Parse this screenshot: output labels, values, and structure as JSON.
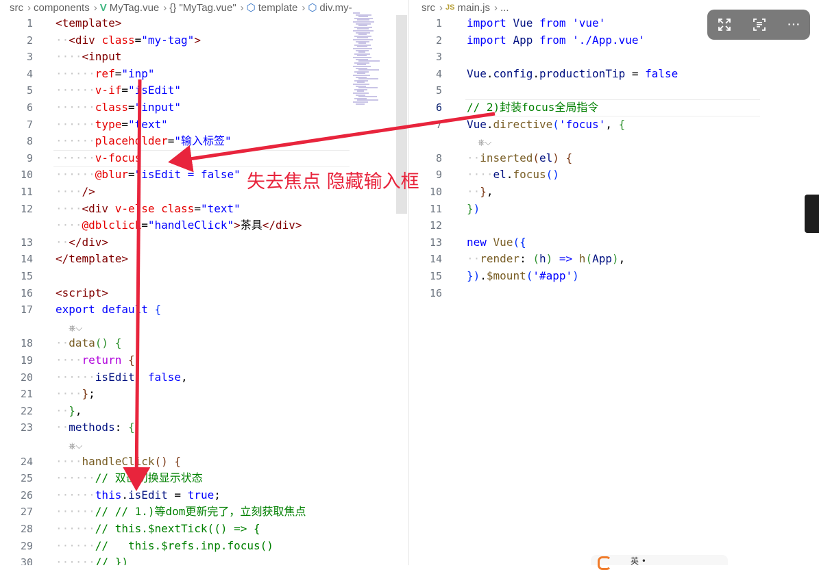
{
  "left_editor": {
    "breadcrumb": [
      "src",
      "components",
      "MyTag.vue",
      "{} \"MyTag.vue\"",
      "template",
      "div.my-"
    ],
    "codelens": "⎈⌵",
    "lines": [
      {
        "n": "1",
        "tokens": [
          [
            "t",
            "<template>"
          ]
        ]
      },
      {
        "n": "2",
        "tokens": [
          [
            "g",
            "··"
          ],
          [
            "t",
            "<div"
          ],
          [
            "p",
            " "
          ],
          [
            "a",
            "class"
          ],
          [
            "p",
            "="
          ],
          [
            "s",
            "\"my-tag\""
          ],
          [
            "t",
            ">"
          ]
        ]
      },
      {
        "n": "3",
        "tokens": [
          [
            "g",
            "····"
          ],
          [
            "t",
            "<input"
          ]
        ]
      },
      {
        "n": "4",
        "tokens": [
          [
            "g",
            "······"
          ],
          [
            "a",
            "ref"
          ],
          [
            "p",
            "="
          ],
          [
            "s",
            "\"inp\""
          ]
        ]
      },
      {
        "n": "5",
        "tokens": [
          [
            "g",
            "······"
          ],
          [
            "a",
            "v-if"
          ],
          [
            "p",
            "="
          ],
          [
            "s",
            "\"isEdit\""
          ]
        ]
      },
      {
        "n": "6",
        "tokens": [
          [
            "g",
            "······"
          ],
          [
            "a",
            "class"
          ],
          [
            "p",
            "="
          ],
          [
            "s",
            "\"input\""
          ]
        ]
      },
      {
        "n": "7",
        "tokens": [
          [
            "g",
            "······"
          ],
          [
            "a",
            "type"
          ],
          [
            "p",
            "="
          ],
          [
            "s",
            "\"text\""
          ]
        ]
      },
      {
        "n": "8",
        "tokens": [
          [
            "g",
            "······"
          ],
          [
            "a",
            "placeholder"
          ],
          [
            "p",
            "="
          ],
          [
            "s",
            "\"输入标签\""
          ]
        ]
      },
      {
        "n": "9",
        "tokens": [
          [
            "g",
            "······"
          ],
          [
            "a",
            "v-focus"
          ]
        ]
      },
      {
        "n": "10",
        "tokens": [
          [
            "g",
            "······"
          ],
          [
            "a",
            "@blur"
          ],
          [
            "p",
            "="
          ],
          [
            "s",
            "\"isEdit = false\""
          ]
        ]
      },
      {
        "n": "11",
        "tokens": [
          [
            "g",
            "····"
          ],
          [
            "t",
            "/>"
          ]
        ]
      },
      {
        "n": "12",
        "tokens": [
          [
            "g",
            "····"
          ],
          [
            "t",
            "<div"
          ],
          [
            "p",
            " "
          ],
          [
            "a",
            "v-else"
          ],
          [
            "p",
            " "
          ],
          [
            "a",
            "class"
          ],
          [
            "p",
            "="
          ],
          [
            "s",
            "\"text\""
          ],
          [
            "g",
            " "
          ]
        ]
      },
      {
        "n": "",
        "tokens": [
          [
            "g",
            "····"
          ],
          [
            "a",
            "@dblclick"
          ],
          [
            "p",
            "="
          ],
          [
            "s",
            "\"handleClick\""
          ],
          [
            "t",
            ">"
          ],
          [
            "p",
            "茶具"
          ],
          [
            "t",
            "</div>"
          ]
        ]
      },
      {
        "n": "13",
        "tokens": [
          [
            "g",
            "··"
          ],
          [
            "t",
            "</div>"
          ]
        ]
      },
      {
        "n": "14",
        "tokens": [
          [
            "t",
            "</template>"
          ]
        ]
      },
      {
        "n": "15",
        "tokens": []
      },
      {
        "n": "16",
        "tokens": [
          [
            "t",
            "<script>"
          ]
        ]
      },
      {
        "n": "17",
        "tokens": [
          [
            "k",
            "export"
          ],
          [
            "p",
            " "
          ],
          [
            "k",
            "default"
          ],
          [
            "p",
            " "
          ],
          [
            "b1",
            "{"
          ]
        ]
      },
      {
        "n": "",
        "tokens": [],
        "lens": true
      },
      {
        "n": "18",
        "tokens": [
          [
            "g",
            "··"
          ],
          [
            "f",
            "data"
          ],
          [
            "b2",
            "()"
          ],
          [
            "p",
            " "
          ],
          [
            "b2",
            "{"
          ]
        ]
      },
      {
        "n": "19",
        "tokens": [
          [
            "g",
            "····"
          ],
          [
            "x",
            "return"
          ],
          [
            "p",
            " "
          ],
          [
            "b3",
            "{"
          ]
        ]
      },
      {
        "n": "20",
        "tokens": [
          [
            "g",
            "······"
          ],
          [
            "v",
            "isEdit"
          ],
          [
            "p",
            ": "
          ],
          [
            "k",
            "false"
          ],
          [
            "p",
            ","
          ]
        ]
      },
      {
        "n": "21",
        "tokens": [
          [
            "g",
            "····"
          ],
          [
            "b3",
            "}"
          ],
          [
            "p",
            ";"
          ]
        ]
      },
      {
        "n": "22",
        "tokens": [
          [
            "g",
            "··"
          ],
          [
            "b2",
            "}"
          ],
          [
            "p",
            ","
          ]
        ]
      },
      {
        "n": "23",
        "tokens": [
          [
            "g",
            "··"
          ],
          [
            "v",
            "methods"
          ],
          [
            "p",
            ": "
          ],
          [
            "b2",
            "{"
          ]
        ]
      },
      {
        "n": "",
        "tokens": [],
        "lens": true
      },
      {
        "n": "24",
        "tokens": [
          [
            "g",
            "····"
          ],
          [
            "f",
            "handleClick"
          ],
          [
            "b3",
            "()"
          ],
          [
            "p",
            " "
          ],
          [
            "b3",
            "{"
          ]
        ]
      },
      {
        "n": "25",
        "tokens": [
          [
            "g",
            "······"
          ],
          [
            "c",
            "// 双击切换显示状态"
          ]
        ]
      },
      {
        "n": "26",
        "tokens": [
          [
            "g",
            "······"
          ],
          [
            "k",
            "this"
          ],
          [
            "p",
            "."
          ],
          [
            "v",
            "isEdit"
          ],
          [
            "p",
            " = "
          ],
          [
            "k",
            "true"
          ],
          [
            "p",
            ";"
          ]
        ]
      },
      {
        "n": "27",
        "tokens": [
          [
            "g",
            "······"
          ],
          [
            "c",
            "// // 1.)等dom更新完了，立刻获取焦点"
          ]
        ]
      },
      {
        "n": "28",
        "tokens": [
          [
            "g",
            "······"
          ],
          [
            "c",
            "// this.$nextTick(() => {"
          ]
        ]
      },
      {
        "n": "29",
        "tokens": [
          [
            "g",
            "······"
          ],
          [
            "c",
            "//   this.$refs.inp.focus()"
          ]
        ]
      },
      {
        "n": "30",
        "tokens": [
          [
            "g",
            "······"
          ],
          [
            "c",
            "// })"
          ]
        ]
      }
    ]
  },
  "right_editor": {
    "breadcrumb": [
      "src",
      "JS",
      "main.js",
      "..."
    ],
    "codelens": "⎈⌵",
    "lines": [
      {
        "n": "1",
        "tokens": [
          [
            "k",
            "import"
          ],
          [
            "p",
            " "
          ],
          [
            "v",
            "Vue"
          ],
          [
            "p",
            " "
          ],
          [
            "k",
            "from"
          ],
          [
            "p",
            " "
          ],
          [
            "s2",
            "'vue'"
          ]
        ]
      },
      {
        "n": "2",
        "tokens": [
          [
            "k",
            "import"
          ],
          [
            "p",
            " "
          ],
          [
            "v",
            "App"
          ],
          [
            "p",
            " "
          ],
          [
            "k",
            "from"
          ],
          [
            "p",
            " "
          ],
          [
            "s2",
            "'./App.vue'"
          ]
        ]
      },
      {
        "n": "3",
        "tokens": []
      },
      {
        "n": "4",
        "tokens": [
          [
            "v",
            "Vue"
          ],
          [
            "p",
            "."
          ],
          [
            "v",
            "config"
          ],
          [
            "p",
            "."
          ],
          [
            "v",
            "productionTip"
          ],
          [
            "p",
            " = "
          ],
          [
            "k",
            "false"
          ]
        ]
      },
      {
        "n": "5",
        "tokens": []
      },
      {
        "n": "6",
        "tokens": [
          [
            "c",
            "// 2)封装focus全局指令"
          ]
        ],
        "active": true
      },
      {
        "n": "7",
        "tokens": [
          [
            "v",
            "Vue"
          ],
          [
            "p",
            "."
          ],
          [
            "f",
            "directive"
          ],
          [
            "b1",
            "("
          ],
          [
            "s2",
            "'focus'"
          ],
          [
            "p",
            ", "
          ],
          [
            "b2",
            "{"
          ]
        ]
      },
      {
        "n": "",
        "tokens": [],
        "lens": true
      },
      {
        "n": "8",
        "tokens": [
          [
            "g",
            "··"
          ],
          [
            "f",
            "inserted"
          ],
          [
            "b3",
            "("
          ],
          [
            "v",
            "el"
          ],
          [
            "b3",
            ")"
          ],
          [
            "p",
            " "
          ],
          [
            "b3",
            "{"
          ]
        ]
      },
      {
        "n": "9",
        "tokens": [
          [
            "g",
            "····"
          ],
          [
            "v",
            "el"
          ],
          [
            "p",
            "."
          ],
          [
            "f",
            "focus"
          ],
          [
            "b1",
            "()"
          ]
        ]
      },
      {
        "n": "10",
        "tokens": [
          [
            "g",
            "··"
          ],
          [
            "b3",
            "}"
          ],
          [
            "p",
            ","
          ]
        ]
      },
      {
        "n": "11",
        "tokens": [
          [
            "b2",
            "}"
          ],
          [
            "b1",
            ")"
          ]
        ]
      },
      {
        "n": "12",
        "tokens": []
      },
      {
        "n": "13",
        "tokens": [
          [
            "k",
            "new"
          ],
          [
            "p",
            " "
          ],
          [
            "f",
            "Vue"
          ],
          [
            "b1",
            "({"
          ]
        ]
      },
      {
        "n": "14",
        "tokens": [
          [
            "g",
            "··"
          ],
          [
            "f",
            "render"
          ],
          [
            "p",
            ": "
          ],
          [
            "b2",
            "("
          ],
          [
            "v",
            "h"
          ],
          [
            "b2",
            ")"
          ],
          [
            "p",
            " "
          ],
          [
            "k",
            "=>"
          ],
          [
            "p",
            " "
          ],
          [
            "f",
            "h"
          ],
          [
            "b2",
            "("
          ],
          [
            "v",
            "App"
          ],
          [
            "b2",
            ")"
          ],
          [
            "p",
            ","
          ]
        ]
      },
      {
        "n": "15",
        "tokens": [
          [
            "b1",
            "})"
          ],
          [
            "p",
            "."
          ],
          [
            "f",
            "$mount"
          ],
          [
            "b1",
            "("
          ],
          [
            "s2",
            "'#app'"
          ],
          [
            "b1",
            ")"
          ]
        ]
      },
      {
        "n": "16",
        "tokens": []
      }
    ]
  },
  "annotation": {
    "text": "失去焦点 隐藏输入框",
    "color": "#e8243c"
  },
  "overlay_toolbar": {
    "icons": [
      "expand-icon",
      "scan-text-icon",
      "more-icon"
    ],
    "more_label": "···"
  },
  "bottom_bar": {
    "text": "英 •"
  }
}
